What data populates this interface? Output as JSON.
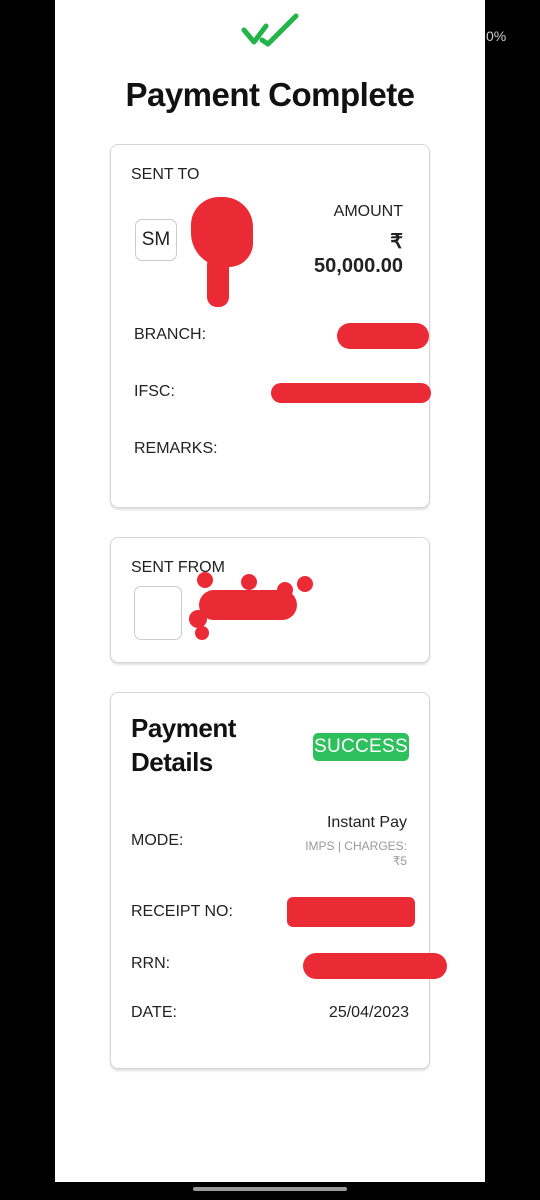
{
  "status_bar": {
    "battery_fragment": "0%"
  },
  "header": {
    "title": "Payment Complete",
    "icon": "double-check-icon",
    "icon_color": "#22b34a"
  },
  "sent_to": {
    "heading": "SENT TO",
    "avatar_initials": "SM",
    "amount_label": "AMOUNT",
    "currency_symbol": "₹",
    "amount": "50,000.00",
    "branch_label": "BRANCH:",
    "ifsc_label": "IFSC:",
    "remarks_label": "REMARKS:"
  },
  "sent_from": {
    "heading": "SENT FROM"
  },
  "payment_details": {
    "heading_line1": "Payment",
    "heading_line2": "Details",
    "status": "SUCCESS",
    "status_color": "#2ec05c",
    "mode_label": "MODE:",
    "mode_value": "Instant Pay",
    "mode_sub": "IMPS | CHARGES:",
    "mode_charge": "₹5",
    "receipt_label": "RECEIPT NO:",
    "rrn_label": "RRN:",
    "date_label": "DATE:",
    "date_value": "25/04/2023"
  },
  "redaction_color": "#ea2b35"
}
